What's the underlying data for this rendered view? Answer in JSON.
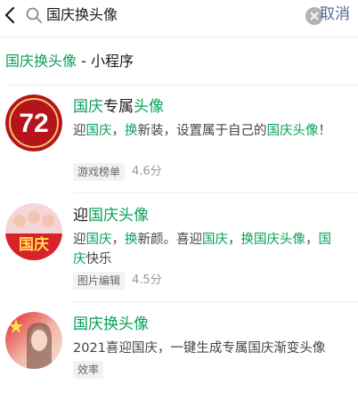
{
  "search": {
    "query": "国庆换头像",
    "cancel_label": "取消"
  },
  "section": {
    "highlight": "国庆换头像",
    "suffix": " - 小程序"
  },
  "results": [
    {
      "title_hl": "国庆",
      "title_plain": "专属",
      "title_hl2": "头像",
      "desc_parts": [
        "迎",
        "国庆",
        "，",
        "换",
        "新装，设置属于自己的",
        "国庆头",
        "像",
        "！"
      ],
      "tag": "游戏榜单",
      "rating": "4.6分",
      "avatar_text": "72"
    },
    {
      "title_plain": "迎",
      "title_hl": "国庆头像",
      "desc_parts": [
        "迎",
        "国庆",
        "，",
        "换",
        "新颜。喜迎",
        "国庆",
        "，",
        "换国庆头像",
        "，",
        "国庆",
        "快乐"
      ],
      "tag": "图片编辑",
      "rating": "4.5分",
      "avatar_text": "国庆"
    },
    {
      "title_hl": "国庆换头像",
      "desc": "2021喜迎国庆，一键生成专属国庆渐变头像",
      "tag": "效率"
    }
  ],
  "colors": {
    "highlight": "#07a058",
    "link": "#576b95"
  }
}
